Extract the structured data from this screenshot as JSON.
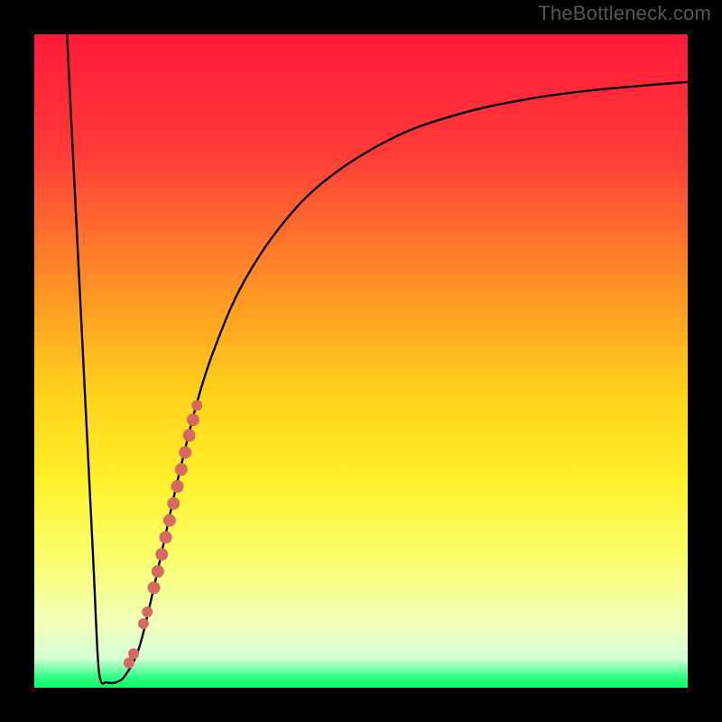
{
  "watermark": "TheBottleneck.com",
  "chart_data": {
    "type": "line",
    "title": "",
    "xlabel": "",
    "ylabel": "",
    "xlim": [
      0,
      100
    ],
    "ylim": [
      0,
      100
    ],
    "gradient_stops": [
      {
        "offset": 0.0,
        "color": "#ff1a3a"
      },
      {
        "offset": 0.18,
        "color": "#ff3b38"
      },
      {
        "offset": 0.38,
        "color": "#ff8f26"
      },
      {
        "offset": 0.55,
        "color": "#ffd21a"
      },
      {
        "offset": 0.68,
        "color": "#fff02a"
      },
      {
        "offset": 0.8,
        "color": "#faff6c"
      },
      {
        "offset": 0.9,
        "color": "#f3ffb8"
      },
      {
        "offset": 0.955,
        "color": "#d6ffd6"
      },
      {
        "offset": 0.985,
        "color": "#2aff82"
      },
      {
        "offset": 1.0,
        "color": "#0aff62"
      }
    ],
    "series": [
      {
        "name": "bottleneck-curve",
        "type": "line",
        "points": [
          {
            "x": 5.0,
            "y": 100.0
          },
          {
            "x": 6.0,
            "y": 80.0
          },
          {
            "x": 7.0,
            "y": 60.0
          },
          {
            "x": 8.0,
            "y": 40.0
          },
          {
            "x": 9.0,
            "y": 20.0
          },
          {
            "x": 9.7,
            "y": 5.0
          },
          {
            "x": 10.2,
            "y": 1.0
          },
          {
            "x": 11.0,
            "y": 0.8
          },
          {
            "x": 12.5,
            "y": 0.8
          },
          {
            "x": 14.0,
            "y": 2.0
          },
          {
            "x": 16.0,
            "y": 6.0
          },
          {
            "x": 18.0,
            "y": 14.0
          },
          {
            "x": 20.0,
            "y": 23.0
          },
          {
            "x": 22.0,
            "y": 32.0
          },
          {
            "x": 25.0,
            "y": 44.0
          },
          {
            "x": 28.0,
            "y": 53.0
          },
          {
            "x": 32.0,
            "y": 62.0
          },
          {
            "x": 38.0,
            "y": 71.0
          },
          {
            "x": 45.0,
            "y": 78.0
          },
          {
            "x": 55.0,
            "y": 84.2
          },
          {
            "x": 65.0,
            "y": 87.8
          },
          {
            "x": 75.0,
            "y": 90.0
          },
          {
            "x": 85.0,
            "y": 91.4
          },
          {
            "x": 95.0,
            "y": 92.3
          },
          {
            "x": 100.0,
            "y": 92.7
          }
        ]
      },
      {
        "name": "highlight-strip",
        "type": "scatter",
        "color": "#d66a62",
        "points": [
          {
            "x": 14.5,
            "y": 3.8,
            "r": 6
          },
          {
            "x": 15.2,
            "y": 5.2,
            "r": 6
          },
          {
            "x": 16.7,
            "y": 9.8,
            "r": 6
          },
          {
            "x": 17.3,
            "y": 11.6,
            "r": 6
          },
          {
            "x": 18.3,
            "y": 15.3,
            "r": 7
          },
          {
            "x": 18.9,
            "y": 17.8,
            "r": 7
          },
          {
            "x": 19.5,
            "y": 20.4,
            "r": 7
          },
          {
            "x": 20.1,
            "y": 23.0,
            "r": 7
          },
          {
            "x": 20.7,
            "y": 25.6,
            "r": 7
          },
          {
            "x": 21.3,
            "y": 28.2,
            "r": 7
          },
          {
            "x": 21.9,
            "y": 30.8,
            "r": 7
          },
          {
            "x": 22.5,
            "y": 33.4,
            "r": 7
          },
          {
            "x": 23.1,
            "y": 36.0,
            "r": 7
          },
          {
            "x": 23.7,
            "y": 38.6,
            "r": 7
          },
          {
            "x": 24.3,
            "y": 41.0,
            "r": 7
          },
          {
            "x": 24.9,
            "y": 43.2,
            "r": 6
          }
        ]
      }
    ]
  }
}
